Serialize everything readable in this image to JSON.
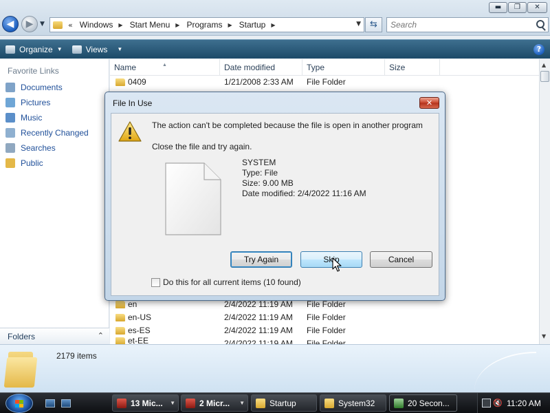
{
  "window": {
    "breadcrumb_prefix": "«",
    "breadcrumbs": [
      "Windows",
      "Start Menu",
      "Programs",
      "Startup"
    ],
    "search_placeholder": "Search",
    "controls": {
      "minimize": "▬",
      "maximize": "❐",
      "close": "✕"
    }
  },
  "toolbar": {
    "organize_label": "Organize",
    "views_label": "Views",
    "help_label": "?"
  },
  "navpane": {
    "heading": "Favorite Links",
    "links": [
      {
        "label": "Documents",
        "icon": "documents-icon",
        "color": "#7fa3c8"
      },
      {
        "label": "Pictures",
        "icon": "pictures-icon",
        "color": "#6fa6d6"
      },
      {
        "label": "Music",
        "icon": "music-icon",
        "color": "#5b8fc9"
      },
      {
        "label": "Recently Changed",
        "icon": "recently-changed-icon",
        "color": "#8fb0d0"
      },
      {
        "label": "Searches",
        "icon": "searches-icon",
        "color": "#90a8c0"
      },
      {
        "label": "Public",
        "icon": "public-folder-icon",
        "color": "#e4b848"
      }
    ],
    "folders_label": "Folders",
    "folders_chevron": "⌃"
  },
  "filelist": {
    "columns": [
      "Name",
      "Date modified",
      "Type",
      "Size"
    ],
    "rows": [
      {
        "name": "0409",
        "date": "1/21/2008 2:33 AM",
        "type": "File Folder",
        "size": ""
      },
      {
        "name": "en",
        "date": "2/4/2022 11:19 AM",
        "type": "File Folder",
        "size": ""
      },
      {
        "name": "en-US",
        "date": "2/4/2022 11:19 AM",
        "type": "File Folder",
        "size": ""
      },
      {
        "name": "es-ES",
        "date": "2/4/2022 11:19 AM",
        "type": "File Folder",
        "size": ""
      },
      {
        "name": "et-EE",
        "date": "2/4/2022 11:19 AM",
        "type": "File Folder",
        "size": ""
      }
    ]
  },
  "details": {
    "item_count": "2179 items"
  },
  "dialog": {
    "title": "File In Use",
    "close_label": "✕",
    "message": "The action can't be completed because the file is open in another program",
    "instruction": "Close the file and try again.",
    "file": {
      "name": "SYSTEM",
      "type": "Type: File",
      "size": "Size: 9.00 MB",
      "modified": "Date modified: 2/4/2022 11:16 AM"
    },
    "buttons": {
      "try_again": "Try Again",
      "skip": "Skip",
      "cancel": "Cancel"
    },
    "checkbox_label": "Do this for all current items (10 found)"
  },
  "taskbar": {
    "buttons": [
      {
        "label": "13 Mic...",
        "icon": "word-group-icon",
        "has_caret": true
      },
      {
        "label": "2 Micr...",
        "icon": "app-group-icon",
        "has_caret": true
      },
      {
        "label": "Startup",
        "icon": "folder-icon",
        "has_caret": false
      },
      {
        "label": "System32",
        "icon": "folder-icon",
        "has_caret": false
      },
      {
        "label": "20 Secon...",
        "icon": "progress-icon",
        "has_caret": false
      }
    ],
    "clock": "11:20 AM"
  }
}
